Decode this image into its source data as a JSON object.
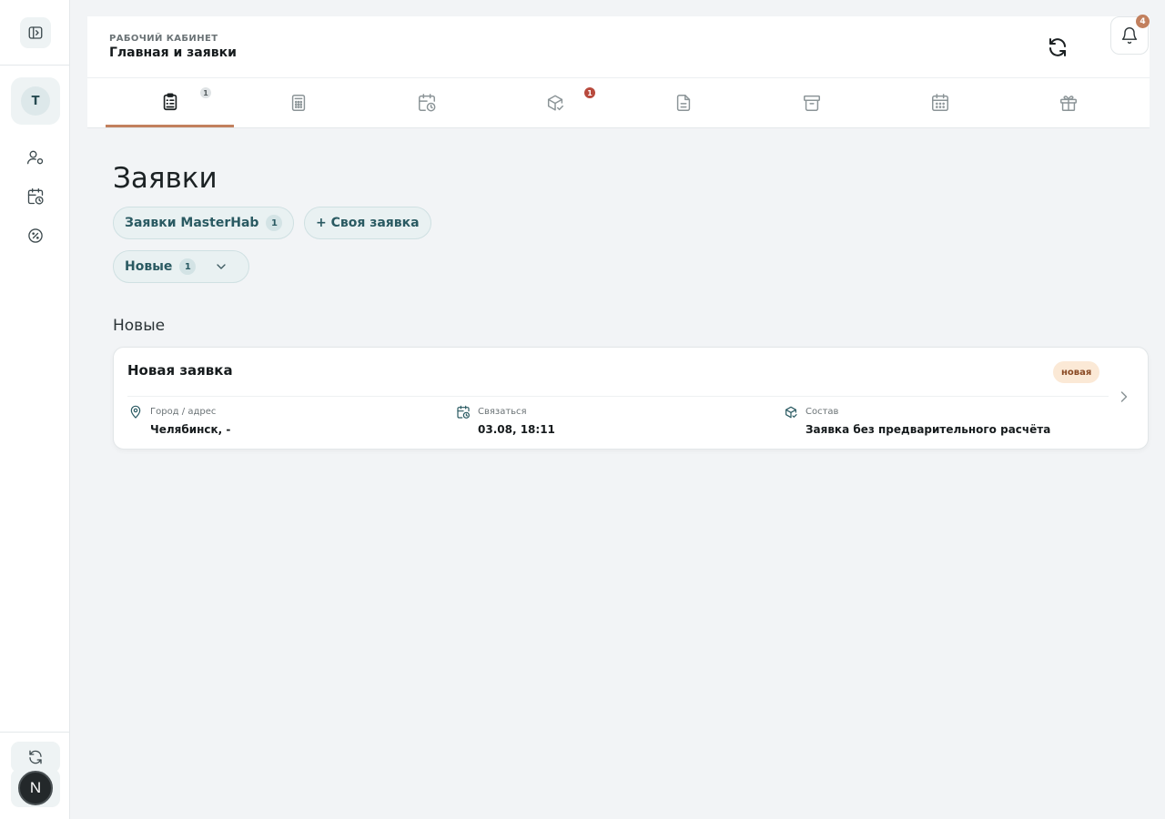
{
  "header": {
    "eyebrow": "РАБОЧИЙ КАБИНЕТ",
    "title": "Главная и заявки",
    "notifications_count": "4"
  },
  "sidebar": {
    "avatar_letter": "Т",
    "user_letter": "N",
    "icons": [
      "panel-toggle-icon",
      "user-settings-icon",
      "calendar-clock-icon",
      "discount-icon",
      "sync-icon"
    ]
  },
  "tabs": [
    {
      "icon": "clipboard-list-icon",
      "badge": "1",
      "active": true
    },
    {
      "icon": "calculator-icon",
      "badge": ""
    },
    {
      "icon": "calendar-clock-icon",
      "badge": ""
    },
    {
      "icon": "package-check-icon",
      "badge": "1"
    },
    {
      "icon": "document-icon",
      "badge": ""
    },
    {
      "icon": "archive-icon",
      "badge": ""
    },
    {
      "icon": "calendar-grid-icon",
      "badge": ""
    },
    {
      "icon": "gift-icon",
      "badge": ""
    }
  ],
  "main": {
    "title": "Заявки",
    "pills": {
      "masterhab_label": "Заявки MasterHab",
      "masterhab_count": "1",
      "own_label": "+ Своя заявка",
      "filter_label": "Новые",
      "filter_count": "1"
    },
    "section_label": "Новые",
    "card": {
      "title": "Новая заявка",
      "status": "новая",
      "fields": [
        {
          "label": "Город / адрес",
          "value": "Челябинск, -",
          "icon": "location-pin-icon"
        },
        {
          "label": "Связаться",
          "value": "03.08, 18:11",
          "icon": "calendar-clock-icon"
        },
        {
          "label": "Состав",
          "value": "Заявка без предварительного расчёта",
          "icon": "package-icon"
        }
      ]
    }
  },
  "colors": {
    "accent": "#c2805e",
    "teal": "#2a5a62",
    "badge_red": "#b84a3d",
    "background": "#f2f4f6"
  }
}
